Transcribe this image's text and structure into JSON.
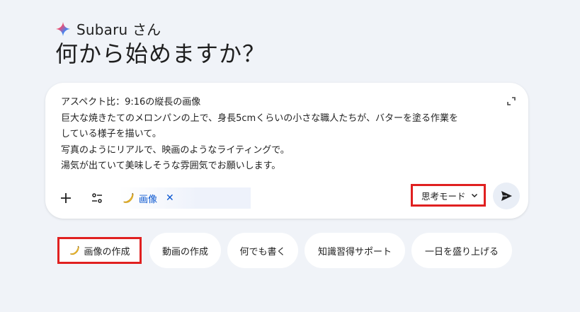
{
  "greeting": {
    "name": "Subaru さん",
    "headline": "何から始めますか？"
  },
  "composer": {
    "prompt_lines": [
      "アスペクト比：9:16の縦長の画像",
      "巨大な焼きたてのメロンパンの上で、身長5cmくらいの小さな職人たちが、バターを塗る作業を",
      "している様子を描いて。",
      "写真のようにリアルで、映画のようなライティングで。",
      "湯気が出ていて美味しそうな雰囲気でお願いします。"
    ],
    "tool_chip": {
      "label": "画像",
      "icon": "banana-icon",
      "close": "✕"
    },
    "mode": {
      "selected": "思考モード"
    },
    "icons": {
      "add": "plus-icon",
      "tools": "tune-icon",
      "expand": "expand-icon",
      "send": "send-icon"
    }
  },
  "suggestions": [
    {
      "label": "画像の作成",
      "icon": "banana-icon"
    },
    {
      "label": "動画の作成"
    },
    {
      "label": "何でも書く"
    },
    {
      "label": "知識習得サポート"
    },
    {
      "label": "一日を盛り上げる"
    }
  ],
  "colors": {
    "background": "#f0f3f8",
    "accent_blue": "#0b57d0",
    "highlight_red": "#e02020"
  }
}
